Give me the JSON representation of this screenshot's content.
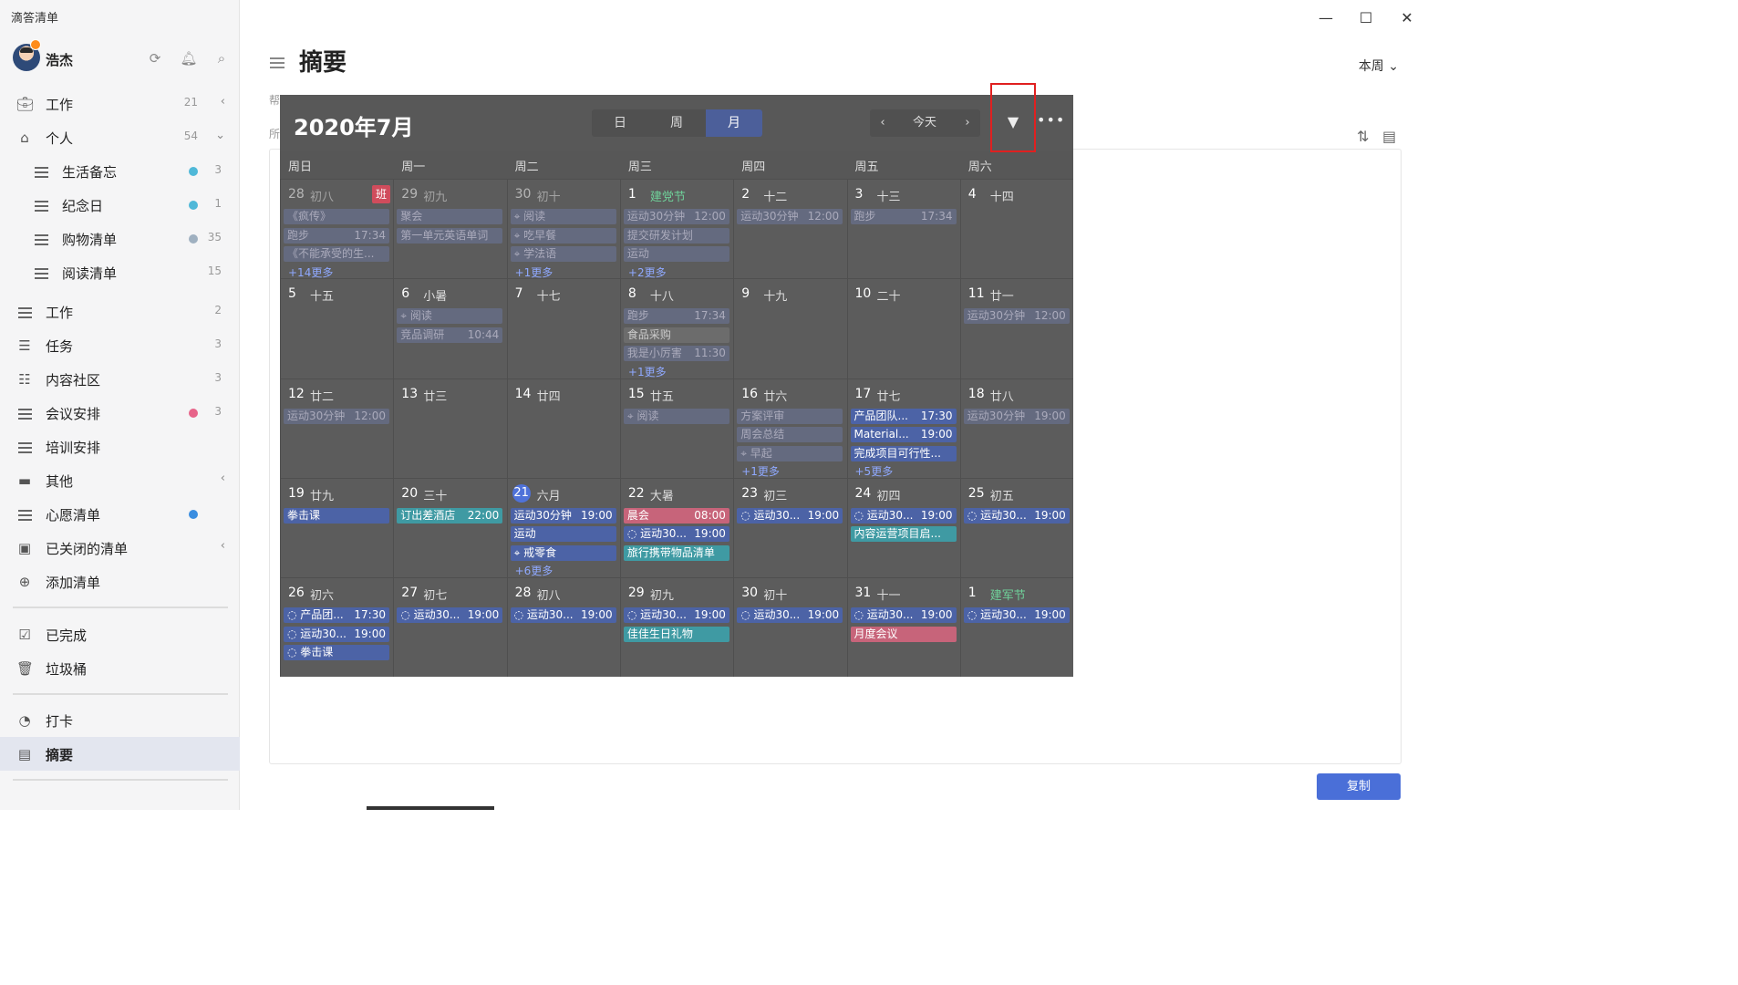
{
  "app": {
    "title": "滴答清单"
  },
  "user": {
    "name": "浩杰"
  },
  "sidebar": {
    "items": [
      {
        "label": "工作",
        "count": "21",
        "chevron": "‹",
        "icon": "briefcase-icon"
      },
      {
        "label": "个人",
        "count": "54",
        "chevron": "⌄",
        "icon": "home-icon"
      },
      {
        "label": "生活备忘",
        "count": "3",
        "dot": "#4fb8d8",
        "icon": "list-icon"
      },
      {
        "label": "纪念日",
        "count": "1",
        "dot": "#4fb8d8",
        "icon": "list-icon"
      },
      {
        "label": "购物清单",
        "count": "35",
        "dot": "#9fb0c0",
        "icon": "list-icon"
      },
      {
        "label": "阅读清单",
        "count": "15",
        "icon": "list-icon"
      },
      {
        "label": "工作",
        "count": "2",
        "icon": "list-icon"
      },
      {
        "label": "任务",
        "count": "3",
        "icon": "task-list-icon"
      },
      {
        "label": "内容社区",
        "count": "3",
        "icon": "shared-list-icon"
      },
      {
        "label": "会议安排",
        "count": "3",
        "dot": "#e7648a",
        "icon": "list-icon"
      },
      {
        "label": "培训安排",
        "icon": "list-icon"
      },
      {
        "label": "其他",
        "chevron": "‹",
        "icon": "folder-icon"
      },
      {
        "label": "心愿清单",
        "dot": "#3a8de0",
        "icon": "list-icon"
      },
      {
        "label": "已关闭的清单",
        "chevron": "‹",
        "icon": "archive-icon"
      },
      {
        "label": "添加清单",
        "icon": "plus-icon"
      },
      {
        "label": "已完成",
        "icon": "checkbox-icon"
      },
      {
        "label": "垃圾桶",
        "icon": "trash-icon"
      },
      {
        "label": "打卡",
        "icon": "clock-icon"
      },
      {
        "label": "摘要",
        "icon": "summary-icon"
      }
    ]
  },
  "main": {
    "title": "摘要",
    "range": "本周",
    "hint1": "帮",
    "hint2": "所",
    "copy_label": "复制"
  },
  "calendar": {
    "title": "2020年7月",
    "views": [
      "日",
      "周",
      "月"
    ],
    "active_view": "月",
    "today_label": "今天",
    "weekdays": [
      "周日",
      "周一",
      "周二",
      "周三",
      "周四",
      "周五",
      "周六"
    ],
    "weeks": [
      [
        {
          "d": "28",
          "l": "初八",
          "dim": true,
          "ban": "班",
          "ev": [
            [
              "《疯传》",
              "",
              "dim"
            ],
            [
              "跑步",
              "17:34",
              "dim"
            ],
            [
              "《不能承受的生...",
              "",
              "dim"
            ]
          ],
          "more": "+14更多"
        },
        {
          "d": "29",
          "l": "初九",
          "dim": true,
          "ev": [
            [
              "聚会",
              "",
              "dim"
            ],
            [
              "第一单元英语单词",
              "",
              "dim"
            ]
          ]
        },
        {
          "d": "30",
          "l": "初十",
          "dim": true,
          "ev": [
            [
              "⌖ 阅读",
              "",
              "dim"
            ],
            [
              "⌖ 吃早餐",
              "",
              "dim"
            ],
            [
              "⌖ 学法语",
              "",
              "dim"
            ]
          ],
          "more": "+1更多"
        },
        {
          "d": "1",
          "l": "建党节",
          "green": true,
          "ev": [
            [
              "运动30分钟",
              "12:00",
              "dim"
            ],
            [
              "提交研发计划",
              "",
              "dim"
            ],
            [
              "运动",
              "",
              "dim"
            ]
          ],
          "more": "+2更多"
        },
        {
          "d": "2",
          "l": "十二",
          "ev": [
            [
              "运动30分钟",
              "12:00",
              "dim"
            ]
          ]
        },
        {
          "d": "3",
          "l": "十三",
          "ev": [
            [
              "跑步",
              "17:34",
              "dim"
            ]
          ]
        },
        {
          "d": "4",
          "l": "十四",
          "ev": []
        }
      ],
      [
        {
          "d": "5",
          "l": "十五",
          "ev": []
        },
        {
          "d": "6",
          "l": "小暑",
          "ev": [
            [
              "⌖ 阅读",
              "",
              "dim"
            ],
            [
              "竞品调研",
              "10:44",
              "dim"
            ]
          ]
        },
        {
          "d": "7",
          "l": "十七",
          "ev": []
        },
        {
          "d": "8",
          "l": "十八",
          "ev": [
            [
              "跑步",
              "17:34",
              "dim"
            ],
            [
              "食品采购",
              "",
              "gray"
            ],
            [
              "我是小厉害",
              "11:30",
              "dim"
            ]
          ],
          "more": "+1更多"
        },
        {
          "d": "9",
          "l": "十九",
          "ev": []
        },
        {
          "d": "10",
          "l": "二十",
          "ev": []
        },
        {
          "d": "11",
          "l": "廿一",
          "ev": [
            [
              "运动30分钟",
              "12:00",
              "dim"
            ]
          ]
        }
      ],
      [
        {
          "d": "12",
          "l": "廿二",
          "ev": [
            [
              "运动30分钟",
              "12:00",
              "dim"
            ]
          ]
        },
        {
          "d": "13",
          "l": "廿三",
          "ev": []
        },
        {
          "d": "14",
          "l": "廿四",
          "ev": []
        },
        {
          "d": "15",
          "l": "廿五",
          "ev": [
            [
              "⌖ 阅读",
              "",
              "dim"
            ]
          ]
        },
        {
          "d": "16",
          "l": "廿六",
          "ev": [
            [
              "方案评审",
              "",
              "dim"
            ],
            [
              "周会总结",
              "",
              "dim"
            ],
            [
              "⌖ 早起",
              "",
              "dim"
            ]
          ],
          "more": "+1更多"
        },
        {
          "d": "17",
          "l": "廿七",
          "ev": [
            [
              "产品团队...",
              "17:30",
              "blue"
            ],
            [
              "Material...",
              "19:00",
              "blue"
            ],
            [
              "完成项目可行性...",
              "",
              "blue"
            ]
          ],
          "more": "+5更多"
        },
        {
          "d": "18",
          "l": "廿八",
          "ev": [
            [
              "运动30分钟",
              "19:00",
              "dim"
            ]
          ]
        }
      ],
      [
        {
          "d": "19",
          "l": "廿九",
          "ev": [
            [
              "拳击课",
              "",
              "blue"
            ]
          ]
        },
        {
          "d": "20",
          "l": "三十",
          "ev": [
            [
              "订出差酒店",
              "22:00",
              "teal"
            ]
          ]
        },
        {
          "d": "21",
          "l": "六月",
          "today": true,
          "ev": [
            [
              "运动30分钟",
              "19:00",
              "blue"
            ],
            [
              "运动",
              "",
              "blue"
            ],
            [
              "⌖ 戒零食",
              "",
              "blue"
            ]
          ],
          "more": "+6更多"
        },
        {
          "d": "22",
          "l": "大暑",
          "ev": [
            [
              "晨会",
              "08:00",
              "pink"
            ],
            [
              "◌ 运动30...",
              "19:00",
              "blue"
            ],
            [
              "旅行携带物品清单",
              "",
              "teal"
            ]
          ]
        },
        {
          "d": "23",
          "l": "初三",
          "ev": [
            [
              "◌ 运动30...",
              "19:00",
              "blue"
            ]
          ]
        },
        {
          "d": "24",
          "l": "初四",
          "ev": [
            [
              "◌ 运动30...",
              "19:00",
              "blue"
            ],
            [
              "内容运营项目启...",
              "",
              "teal"
            ]
          ]
        },
        {
          "d": "25",
          "l": "初五",
          "ev": [
            [
              "◌ 运动30...",
              "19:00",
              "blue"
            ]
          ]
        }
      ],
      [
        {
          "d": "26",
          "l": "初六",
          "ev": [
            [
              "◌ 产品团...",
              "17:30",
              "blue"
            ],
            [
              "◌ 运动30...",
              "19:00",
              "blue"
            ],
            [
              "◌ 拳击课",
              "",
              "blue"
            ]
          ]
        },
        {
          "d": "27",
          "l": "初七",
          "ev": [
            [
              "◌ 运动30...",
              "19:00",
              "blue"
            ]
          ]
        },
        {
          "d": "28",
          "l": "初八",
          "ev": [
            [
              "◌ 运动30...",
              "19:00",
              "blue"
            ]
          ]
        },
        {
          "d": "29",
          "l": "初九",
          "ev": [
            [
              "◌ 运动30...",
              "19:00",
              "blue"
            ],
            [
              "佳佳生日礼物",
              "",
              "teal"
            ]
          ]
        },
        {
          "d": "30",
          "l": "初十",
          "ev": [
            [
              "◌ 运动30...",
              "19:00",
              "blue"
            ]
          ]
        },
        {
          "d": "31",
          "l": "十一",
          "ev": [
            [
              "◌ 运动30...",
              "19:00",
              "blue"
            ],
            [
              "月度会议",
              "",
              "pink"
            ]
          ]
        },
        {
          "d": "1",
          "l": "建军节",
          "green": true,
          "ev": [
            [
              "◌ 运动30...",
              "19:00",
              "blue"
            ]
          ]
        }
      ]
    ]
  }
}
